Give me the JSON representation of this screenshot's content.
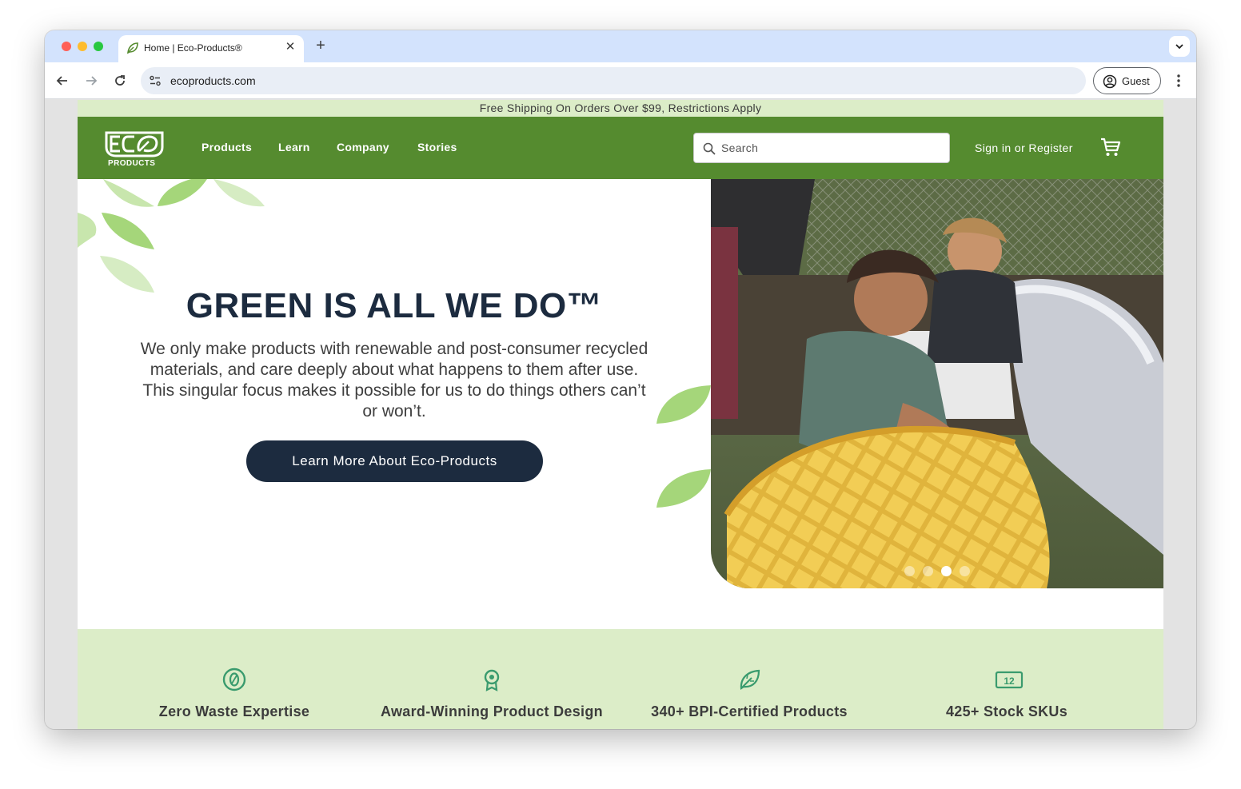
{
  "browser": {
    "tab_title": "Home | Eco-Products®",
    "tab_close_glyph": "✕",
    "new_tab_glyph": "+",
    "url": "ecoproducts.com",
    "profile_label": "Guest"
  },
  "site": {
    "promo": "Free Shipping On Orders Over $99, Restrictions Apply",
    "logo_text": "PRODUCTS",
    "nav": [
      "Products",
      "Learn",
      "Company",
      "Stories"
    ],
    "search_placeholder": "Search",
    "signin": "Sign in or Register",
    "hero": {
      "title": "GREEN IS ALL WE DO™",
      "body": "We only make products with renewable and post-consumer recycled materials, and care deeply about what happens to them after use. This singular focus makes it possible for us to do things others can’t or won’t.",
      "button": "Learn More About Eco-Products",
      "carousel_total": 4,
      "carousel_active": 3
    },
    "features": [
      {
        "label": "Zero Waste Expertise",
        "icon": "zero-icon"
      },
      {
        "label": "Award-Winning Product Design",
        "icon": "award-icon"
      },
      {
        "label": "340+ BPI-Certified Products",
        "icon": "leaf-certified-icon"
      },
      {
        "label": "425+ Stock SKUs",
        "icon": "sku-box-icon"
      }
    ]
  },
  "colors": {
    "brand_green": "#558b2f",
    "light_green": "#dcedc8",
    "navy": "#1c2b3f",
    "leaf": "#a5d67a"
  }
}
